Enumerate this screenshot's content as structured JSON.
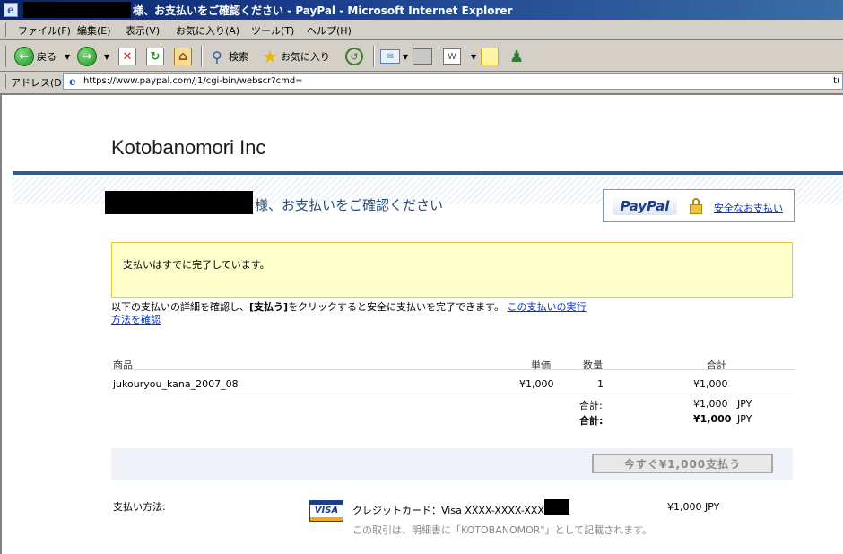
{
  "window": {
    "title": "様、お支払いをご確認ください - PayPal - Microsoft Internet Explorer"
  },
  "menu": {
    "items": [
      "ファイル(F)",
      "編集(E)",
      "表示(V)",
      "お気に入り(A)",
      "ツール(T)",
      "ヘルプ(H)"
    ]
  },
  "toolbar": {
    "back_label": "戻る",
    "search_label": "検索",
    "favorites_label": "お気に入り"
  },
  "address": {
    "label": "アドレス(D)",
    "url": "https://www.paypal.com/j1/cgi-bin/webscr?cmd=",
    "url_tail": "t("
  },
  "page": {
    "merchant_name": "Kotobanomori Inc",
    "heading": "様、お支払いをご確認ください",
    "paypal_logo": "PayPal",
    "secure_link": "安全なお支払い",
    "notice": "支払いはすでに完了しています。",
    "instruction_text": "以下の支払いの詳細を確認し、",
    "instruction_bold": "[支払う]",
    "instruction_text2": "をクリックすると安全に支払いを完了できます。",
    "instruction_link": "この支払いの実行方法を確認"
  },
  "table": {
    "headers": {
      "item": "商品",
      "unit_price": "単価",
      "quantity": "数量",
      "total": "合計"
    },
    "row": {
      "item": "jukouryou_kana_2007_08",
      "unit_price": "¥1,000",
      "quantity": "1",
      "total": "¥1,000"
    },
    "subtotal_label": "合計:",
    "subtotal_value": "¥1,000",
    "subtotal_currency": "JPY",
    "grand_total_label": "合計:",
    "grand_total_value": "¥1,000",
    "grand_total_currency": "JPY"
  },
  "pay_button": "今すぐ¥1,000支払う",
  "payment": {
    "label": "支払い方法:",
    "card_logo": "VISA",
    "card_text": "クレジットカード：Visa XXXX-XXXX-XXXX-",
    "amount": "¥1,000 JPY",
    "statement_note": "この取引は、明細書に「KOTOBANOMOR\"」として記載されます。"
  }
}
